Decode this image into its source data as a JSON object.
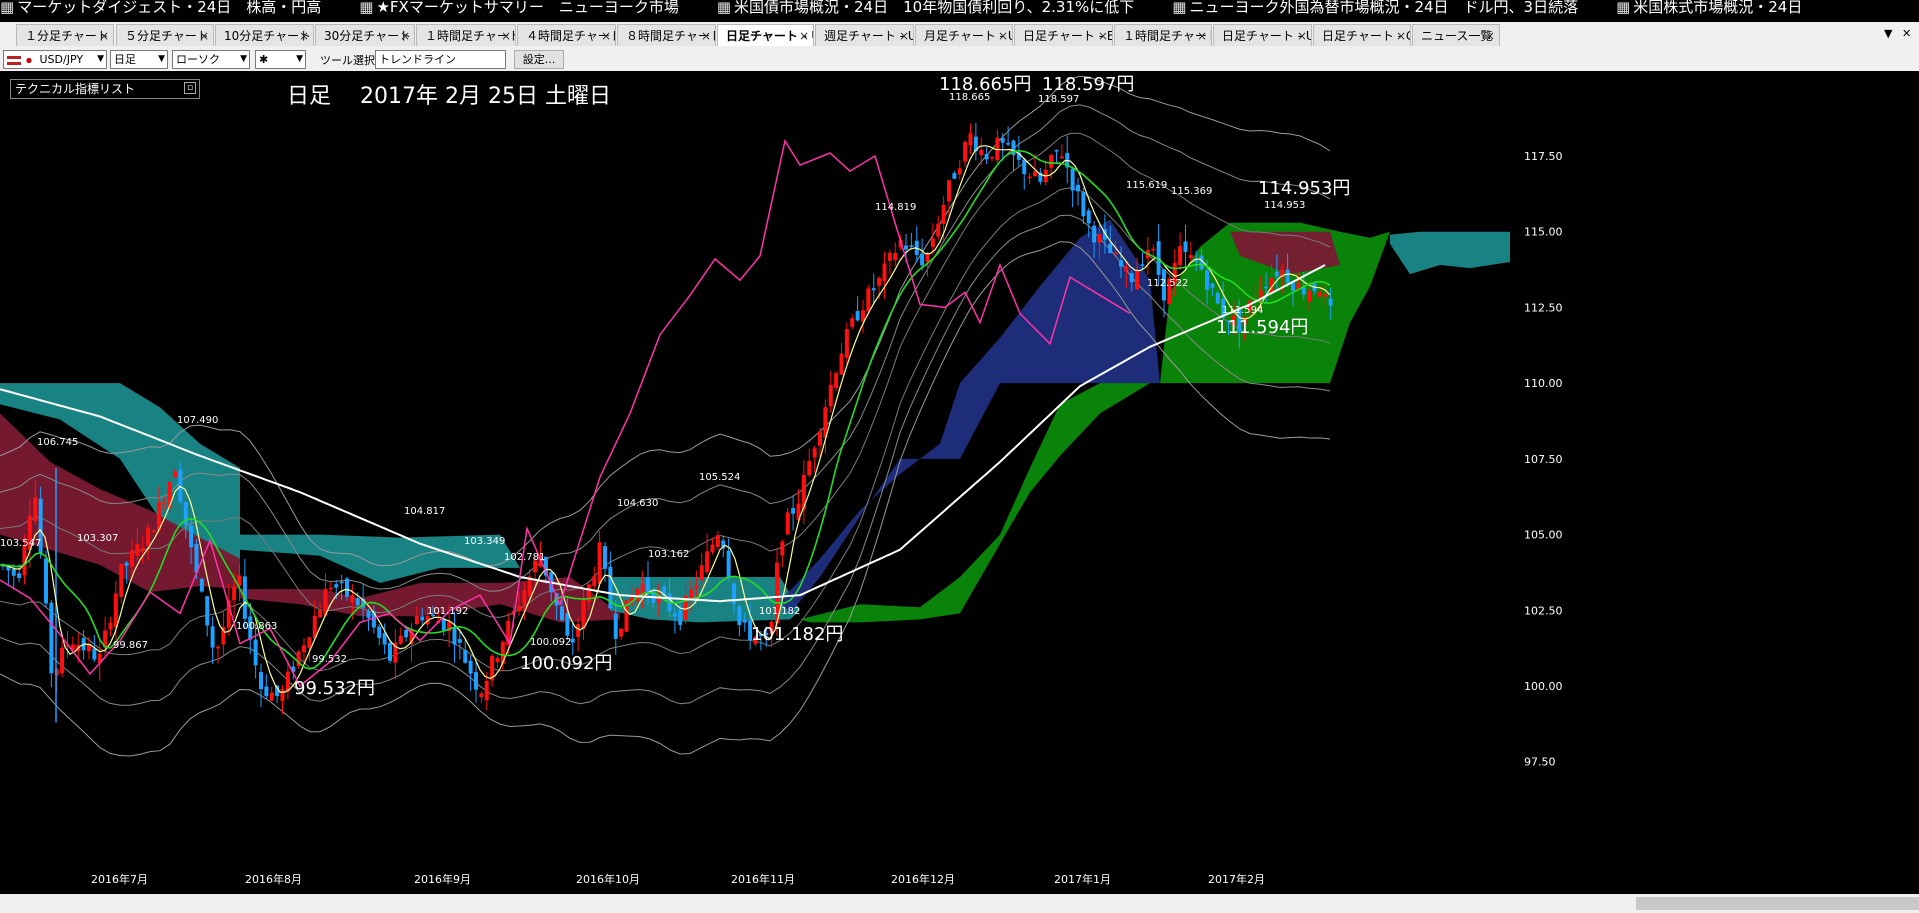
{
  "ticker": {
    "items": [
      "マーケットダイジェスト・24日　株高・円高",
      "★FXマーケットサマリー　ニューヨーク市場",
      "米国債市場概況・24日　10年物国債利回り、2.31%に低下",
      "ニューヨーク外国為替市場概況・24日　ドル円、3日続落",
      "米国株式市場概況・24日"
    ]
  },
  "tabs": [
    {
      "label": "１分足チャート -",
      "active": false
    },
    {
      "label": "５分足チャート -",
      "active": false
    },
    {
      "label": "10分足チャート -",
      "active": false
    },
    {
      "label": "30分足チャート -",
      "active": false
    },
    {
      "label": "１時間足チャート",
      "active": false
    },
    {
      "label": "４時間足チャート",
      "active": false
    },
    {
      "label": "８時間足チャート",
      "active": false
    },
    {
      "label": "日足チャート - U",
      "active": true
    },
    {
      "label": "週足チャート - U:",
      "active": false
    },
    {
      "label": "月足チャート - U:",
      "active": false
    },
    {
      "label": "日足チャート - EU",
      "active": false
    },
    {
      "label": "１時間足チャート",
      "active": false
    },
    {
      "label": "日足チャート - U:",
      "active": false
    },
    {
      "label": "日足チャート - GI",
      "active": false
    },
    {
      "label": "ニュース一覧",
      "active": false
    }
  ],
  "toolbar": {
    "symbol": "USD/JPY",
    "timeframe": "日足",
    "chart_type": "ローソク",
    "marker": "✱",
    "tool_label": "ツール選択",
    "tool_value": "トレンドライン",
    "settings_button": "設定..."
  },
  "indicator_list_title": "テクニカル指標リスト",
  "chart_header": "日足　 2017年 2月 25日 土曜日",
  "colors": {
    "background": "#000000",
    "bull_candle": "#ff1010",
    "bear_candle": "#1ea0ff",
    "cloud_bull": "#0a8a0a",
    "cloud_bear": "#1f2f80",
    "cloud_teal": "#1a8a8a",
    "cloud_maroon": "#7a1a33",
    "ma_long": "#ffffff",
    "ma_mid": "#22dd22",
    "ma_short": "#ffff99",
    "rsi_line": "#ff33aa"
  },
  "chart_data": {
    "type": "candlestick",
    "ylim": [
      97.5,
      118.5
    ],
    "y_ticks": [
      "117.50",
      "115.00",
      "112.50",
      "110.00",
      "107.50",
      "105.00",
      "102.50",
      "100.00",
      "97.50"
    ],
    "x_ticks": [
      "2016年7月",
      "2016年8月",
      "2016年9月",
      "2016年10月",
      "2016年11月",
      "2016年12月",
      "2017年1月",
      "2017年2月"
    ],
    "big_annotations": [
      "118.665円",
      "118.597円",
      "114.953円",
      "111.594円",
      "101.182円",
      "100.092円",
      "99.532円"
    ],
    "small_annotations": [
      "118.665",
      "118.597",
      "114.819",
      "115.619",
      "115.369",
      "114.953",
      "112.522",
      "111.594",
      "107.490",
      "106.745",
      "105.524",
      "104.817",
      "104.630",
      "103.547",
      "103.307",
      "103.349",
      "102.781",
      "103.162",
      "101.192",
      "101.182",
      "100.092",
      "100.863",
      "99.867",
      "99.532"
    ],
    "price_anchors": [
      [
        0,
        104.0
      ],
      [
        18,
        103.6
      ],
      [
        34,
        106.7
      ],
      [
        52,
        100.3
      ],
      [
        70,
        101.6
      ],
      [
        100,
        100.9
      ],
      [
        120,
        103.7
      ],
      [
        150,
        105.1
      ],
      [
        175,
        107.3
      ],
      [
        190,
        104.6
      ],
      [
        215,
        101.0
      ],
      [
        238,
        103.6
      ],
      [
        260,
        100.0
      ],
      [
        280,
        99.6
      ],
      [
        300,
        101.2
      ],
      [
        330,
        103.4
      ],
      [
        360,
        102.7
      ],
      [
        390,
        100.9
      ],
      [
        420,
        102.4
      ],
      [
        450,
        102.0
      ],
      [
        480,
        99.8
      ],
      [
        510,
        102.1
      ],
      [
        540,
        104.4
      ],
      [
        570,
        101.2
      ],
      [
        600,
        104.5
      ],
      [
        615,
        101.8
      ],
      [
        640,
        103.4
      ],
      [
        680,
        102.3
      ],
      [
        700,
        103.7
      ],
      [
        720,
        105.3
      ],
      [
        740,
        101.9
      ],
      [
        770,
        101.4
      ],
      [
        780,
        104.9
      ],
      [
        800,
        106.3
      ],
      [
        820,
        108.7
      ],
      [
        840,
        111.0
      ],
      [
        860,
        112.5
      ],
      [
        880,
        113.4
      ],
      [
        900,
        114.7
      ],
      [
        925,
        114.0
      ],
      [
        940,
        115.6
      ],
      [
        955,
        117.0
      ],
      [
        970,
        118.2
      ],
      [
        985,
        117.5
      ],
      [
        1000,
        117.9
      ],
      [
        1020,
        117.2
      ],
      [
        1040,
        116.6
      ],
      [
        1060,
        117.8
      ],
      [
        1075,
        116.4
      ],
      [
        1090,
        115.1
      ],
      [
        1110,
        114.3
      ],
      [
        1130,
        113.4
      ],
      [
        1150,
        114.6
      ],
      [
        1165,
        112.9
      ],
      [
        1180,
        114.3
      ],
      [
        1200,
        113.9
      ],
      [
        1220,
        112.4
      ],
      [
        1240,
        111.9
      ],
      [
        1260,
        113.2
      ],
      [
        1280,
        113.8
      ],
      [
        1300,
        113.1
      ],
      [
        1320,
        113.2
      ],
      [
        1330,
        112.3
      ]
    ],
    "moving_average_white": [
      [
        0,
        109.8
      ],
      [
        100,
        108.9
      ],
      [
        200,
        107.6
      ],
      [
        300,
        106.4
      ],
      [
        420,
        104.7
      ],
      [
        520,
        103.6
      ],
      [
        620,
        103.0
      ],
      [
        720,
        102.8
      ],
      [
        800,
        103.0
      ],
      [
        900,
        104.5
      ],
      [
        1000,
        107.4
      ],
      [
        1080,
        109.9
      ],
      [
        1150,
        111.2
      ],
      [
        1250,
        112.6
      ],
      [
        1325,
        113.9
      ]
    ],
    "rsi_line": [
      [
        0,
        103.5
      ],
      [
        30,
        102.9
      ],
      [
        60,
        101.7
      ],
      [
        90,
        100.4
      ],
      [
        120,
        101.5
      ],
      [
        150,
        103.1
      ],
      [
        180,
        102.4
      ],
      [
        210,
        104.8
      ],
      [
        240,
        101.4
      ],
      [
        270,
        101.9
      ],
      [
        300,
        100.0
      ],
      [
        330,
        100.8
      ],
      [
        360,
        102.1
      ],
      [
        390,
        102.4
      ],
      [
        420,
        101.5
      ],
      [
        450,
        102.5
      ],
      [
        480,
        103.0
      ],
      [
        510,
        101.4
      ],
      [
        527,
        105.2
      ],
      [
        560,
        102.7
      ],
      [
        600,
        106.9
      ],
      [
        630,
        109.0
      ],
      [
        660,
        111.6
      ],
      [
        690,
        112.9
      ],
      [
        715,
        114.1
      ],
      [
        740,
        113.4
      ],
      [
        760,
        114.2
      ],
      [
        785,
        118.0
      ],
      [
        800,
        117.2
      ],
      [
        830,
        117.6
      ],
      [
        850,
        117.0
      ],
      [
        875,
        117.5
      ],
      [
        895,
        115.3
      ],
      [
        920,
        112.6
      ],
      [
        945,
        112.5
      ],
      [
        965,
        113.0
      ],
      [
        980,
        112.0
      ],
      [
        1000,
        113.9
      ],
      [
        1020,
        112.3
      ],
      [
        1050,
        111.3
      ],
      [
        1070,
        113.5
      ],
      [
        1100,
        112.9
      ],
      [
        1130,
        112.3
      ]
    ]
  }
}
